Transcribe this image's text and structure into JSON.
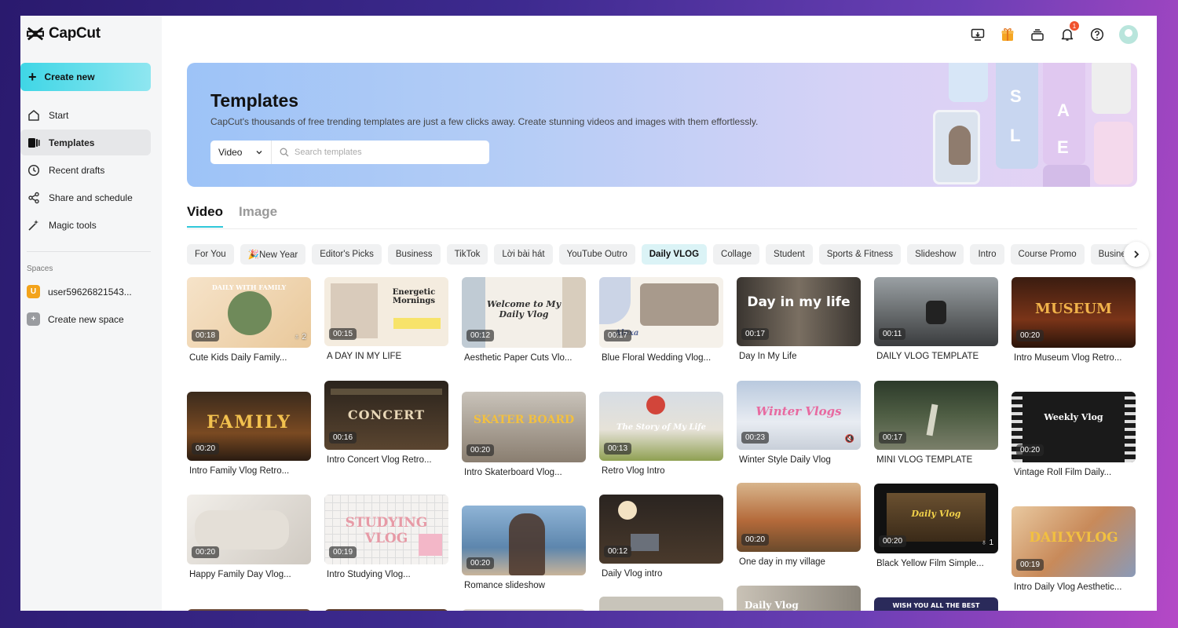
{
  "app": {
    "name": "CapCut"
  },
  "sidebar": {
    "create_label": "Create new",
    "items": [
      {
        "label": "Start",
        "icon": "home-icon"
      },
      {
        "label": "Templates",
        "icon": "templates-icon",
        "active": true
      },
      {
        "label": "Recent drafts",
        "icon": "clock-icon"
      },
      {
        "label": "Share and schedule",
        "icon": "share-icon"
      },
      {
        "label": "Magic tools",
        "icon": "magic-wand-icon"
      }
    ],
    "spaces_label": "Spaces",
    "space_user": "user59626821543...",
    "space_avatar_letter": "U",
    "create_space_label": "Create new space"
  },
  "topbar": {
    "notification_count": "1"
  },
  "banner": {
    "title": "Templates",
    "subtitle": "CapCut's thousands of free trending templates are just a few clicks away. Create stunning videos and images with them effortlessly.",
    "search_type": "Video",
    "search_placeholder": "Search templates",
    "art_letters": [
      "S",
      "A",
      "L",
      "E"
    ]
  },
  "tabs": [
    "Video",
    "Image"
  ],
  "categories": [
    "For You",
    "🎉New Year",
    "Editor's Picks",
    "Business",
    "TikTok",
    "Lời bài hát",
    "YouTube Outro",
    "Daily VLOG",
    "Collage",
    "Student",
    "Sports & Fitness",
    "Slideshow",
    "Intro",
    "Course Promo",
    "Business"
  ],
  "active_category": "Daily VLOG",
  "cards": [
    {
      "title": "Cute Kids Daily Family...",
      "duration": "00:18",
      "uses": "2",
      "overlay": "DAILY WITH FAMILY"
    },
    {
      "title": "A DAY IN MY LIFE",
      "duration": "00:15",
      "overlay": "Energetic Mornings"
    },
    {
      "title": "Aesthetic Paper Cuts Vlo...",
      "duration": "00:12",
      "overlay": "Welcome to My Daily Vlog"
    },
    {
      "title": "Blue Floral Wedding Vlog...",
      "duration": "00:17",
      "overlay": "Alexa"
    },
    {
      "title": "Day In My Life",
      "duration": "00:17",
      "overlay": "Day in my life"
    },
    {
      "title": "DAILY VLOG TEMPLATE",
      "duration": "00:11"
    },
    {
      "title": "Intro Museum Vlog Retro...",
      "duration": "00:20",
      "overlay": "MUSEUM"
    },
    {
      "title": "Intro Family Vlog Retro...",
      "duration": "00:20",
      "overlay": "FAMILY"
    },
    {
      "title": "Intro Concert Vlog Retro...",
      "duration": "00:16",
      "overlay": "CONCERT"
    },
    {
      "title": "Intro Skaterboard Vlog...",
      "duration": "00:20",
      "overlay": "SKATER BOARD"
    },
    {
      "title": "Retro Vlog Intro",
      "duration": "00:13",
      "overlay": "The Story of My Life"
    },
    {
      "title": "Winter Style Daily Vlog",
      "duration": "00:23",
      "overlay": "Winter Vlogs"
    },
    {
      "title": "MINI VLOG TEMPLATE",
      "duration": "00:17"
    },
    {
      "title": "Vintage Roll Film Daily...",
      "duration": "00:20",
      "overlay": "Weekly Vlog"
    },
    {
      "title": "Happy Family Day Vlog...",
      "duration": "00:20"
    },
    {
      "title": "Intro Studying Vlog...",
      "duration": "00:19",
      "overlay": "STUDYING VLOG"
    },
    {
      "title": "Romance slideshow",
      "duration": "00:20"
    },
    {
      "title": "Daily Vlog intro",
      "duration": "00:12"
    },
    {
      "title": "One day in my village",
      "duration": "00:20"
    },
    {
      "title": "Black Yellow Film Simple...",
      "duration": "00:20",
      "uses": "1",
      "overlay": "Daily Vlog"
    },
    {
      "title": "Intro Daily Vlog Aesthetic...",
      "duration": "00:19",
      "overlay": "DAILYVLOG"
    },
    {
      "title": "",
      "duration": "",
      "overlay": "Daily Vlog"
    },
    {
      "title": "",
      "duration": "",
      "overlay": "WISH YOU ALL THE BEST"
    }
  ]
}
